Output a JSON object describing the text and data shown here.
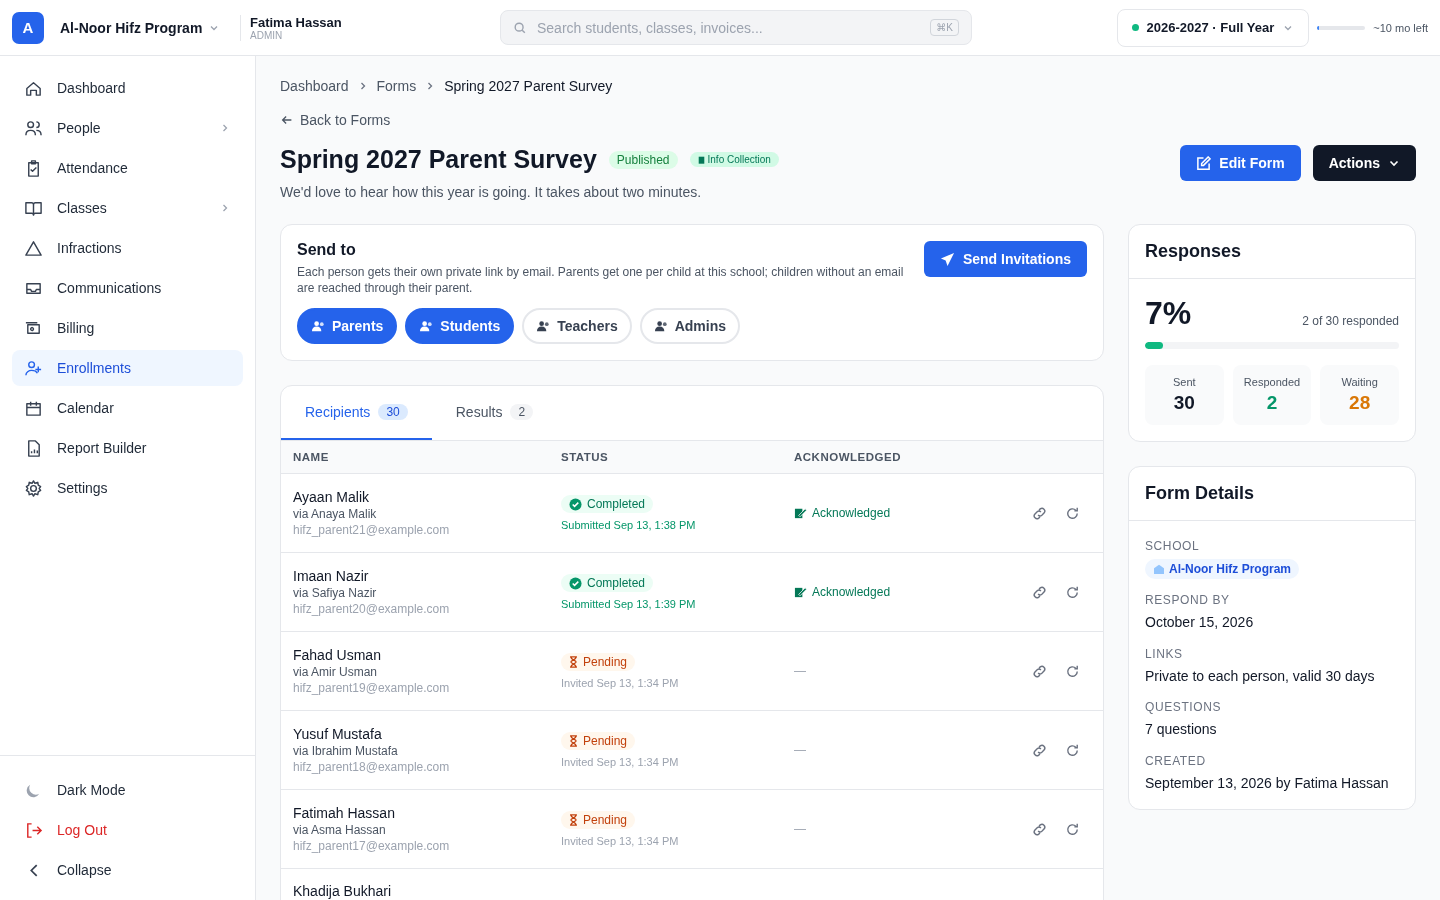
{
  "header": {
    "logo": "A",
    "school": "Al-Noor Hifz Program",
    "user": {
      "name": "Fatima Hassan",
      "role": "ADMIN"
    },
    "search": {
      "placeholder": "Search students, classes, invoices...",
      "shortcut": "⌘K"
    },
    "year": {
      "label": "2026-2027 · Full Year",
      "color": "#10b981"
    },
    "year_progress": {
      "level": 0.03,
      "reading": "~10 mo left"
    }
  },
  "sidebar": {
    "items": [
      {
        "label": "Dashboard",
        "selected": false,
        "has_submenu": false
      },
      {
        "label": "People",
        "selected": false,
        "has_submenu": true
      },
      {
        "label": "Attendance",
        "selected": false,
        "has_submenu": false
      },
      {
        "label": "Classes",
        "selected": false,
        "has_submenu": true
      },
      {
        "label": "Infractions",
        "selected": false,
        "has_submenu": false
      },
      {
        "label": "Communications",
        "selected": false,
        "has_submenu": false
      },
      {
        "label": "Billing",
        "selected": false,
        "has_submenu": false
      },
      {
        "label": "Enrollments",
        "selected": true,
        "has_submenu": false
      },
      {
        "label": "Calendar",
        "selected": false,
        "has_submenu": false
      },
      {
        "label": "Report Builder",
        "selected": false,
        "has_submenu": false
      },
      {
        "label": "Settings",
        "selected": false,
        "has_submenu": false
      }
    ],
    "footer": [
      {
        "label": "Dark Mode",
        "kind": "theme"
      },
      {
        "label": "Log Out",
        "kind": "logout"
      },
      {
        "label": "Collapse",
        "kind": "collapse"
      }
    ]
  },
  "breadcrumb": [
    "Dashboard",
    "Forms",
    "Spring 2027 Parent Survey"
  ],
  "back_link": "Back to Forms",
  "title": "Spring 2027 Parent Survey",
  "badges": [
    {
      "label": "Published",
      "kind": "status"
    },
    {
      "label": "Info Collection",
      "kind": "type"
    }
  ],
  "description": "We'd love to hear how this year is going. It takes about two minutes.",
  "actions": [
    {
      "label": "Edit Form",
      "kind": "primary"
    },
    {
      "label": "Actions",
      "kind": "dark"
    }
  ],
  "send_to": {
    "title": "Send to",
    "text": "Each person gets their own private link by email. Parents get one per child at this school; children without an email are reached through their parent.",
    "button": "Send Invitations",
    "audiences": [
      {
        "label": "Parents",
        "selected": true
      },
      {
        "label": "Students",
        "selected": true
      },
      {
        "label": "Teachers",
        "selected": false
      },
      {
        "label": "Admins",
        "selected": false
      }
    ]
  },
  "tabs": [
    {
      "label": "Recipients",
      "count": "30",
      "selected": true
    },
    {
      "label": "Results",
      "count": "2",
      "selected": false
    }
  ],
  "table": {
    "columns": [
      "NAME",
      "STATUS",
      "ACKNOWLEDGED"
    ],
    "rows": [
      {
        "name": "Ayaan Malik",
        "via": "via Anaya Malik",
        "email": "hifz_parent21@example.com",
        "status": "Completed",
        "kind": "completed",
        "time": "Submitted Sep 13, 1:38 PM",
        "acknowledged": "Acknowledged"
      },
      {
        "name": "Imaan Nazir",
        "via": "via Safiya Nazir",
        "email": "hifz_parent20@example.com",
        "status": "Completed",
        "kind": "completed",
        "time": "Submitted Sep 13, 1:39 PM",
        "acknowledged": "Acknowledged"
      },
      {
        "name": "Fahad Usman",
        "via": "via Amir Usman",
        "email": "hifz_parent19@example.com",
        "status": "Pending",
        "kind": "pending",
        "time": "Invited Sep 13, 1:34 PM",
        "acknowledged": "—"
      },
      {
        "name": "Yusuf Mustafa",
        "via": "via Ibrahim Mustafa",
        "email": "hifz_parent18@example.com",
        "status": "Pending",
        "kind": "pending",
        "time": "Invited Sep 13, 1:34 PM",
        "acknowledged": "—"
      },
      {
        "name": "Fatimah Hassan",
        "via": "via Asma Hassan",
        "email": "hifz_parent17@example.com",
        "status": "Pending",
        "kind": "pending",
        "time": "Invited Sep 13, 1:34 PM",
        "acknowledged": "—"
      },
      {
        "name": "Khadija Bukhari",
        "kind": "partial"
      }
    ]
  },
  "responses": {
    "title": "Responses",
    "percent": "7%",
    "summary": "2 of 30 responded",
    "level": 0.07,
    "stats": [
      {
        "label": "Sent",
        "value": "30",
        "color": "#111827"
      },
      {
        "label": "Responded",
        "value": "2",
        "color": "#059669"
      },
      {
        "label": "Waiting",
        "value": "28",
        "color": "#d97706"
      }
    ]
  },
  "details": {
    "title": "Form Details",
    "school_label": "SCHOOL",
    "school": "Al-Noor Hifz Program",
    "fields": [
      {
        "label": "RESPOND BY",
        "value": "October 15, 2026"
      },
      {
        "label": "LINKS",
        "value": "Private to each person, valid 30 days"
      },
      {
        "label": "QUESTIONS",
        "value": "7 questions"
      },
      {
        "label": "CREATED",
        "value": "September 13, 2026 by Fatima Hassan"
      }
    ]
  }
}
